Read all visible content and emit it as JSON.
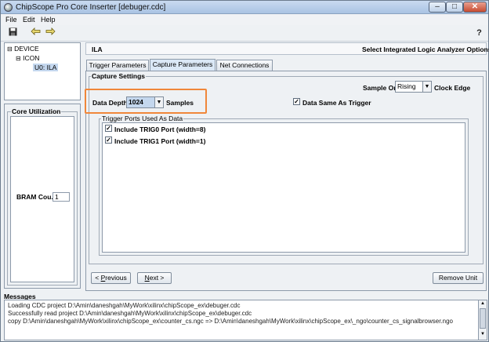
{
  "window": {
    "title": "ChipScope Pro Core Inserter [debuger.cdc]"
  },
  "menu": {
    "file": "File",
    "edit": "Edit",
    "help": "Help"
  },
  "toolbar": {
    "save_icon": "save-icon",
    "back_icon": "arrow-left-icon",
    "forward_icon": "arrow-right-icon",
    "help_icon": "help-icon"
  },
  "tree": {
    "device": "DEVICE",
    "icon": "ICON",
    "ila": "U0: ILA"
  },
  "core_utilization": {
    "title": "Core Utilization",
    "bram_label": "BRAM Cou...",
    "bram_value": "1"
  },
  "header": {
    "core": "ILA",
    "description": "Select Integrated Logic Analyzer Options"
  },
  "tabs": [
    {
      "label": "Trigger Parameters"
    },
    {
      "label": "Capture Parameters"
    },
    {
      "label": "Net Connections"
    }
  ],
  "capture": {
    "group_title": "Capture Settings",
    "sample_on_label": "Sample On",
    "sample_on_value": "Rising",
    "clock_edge_label": "Clock Edge",
    "data_depth_label": "Data Depth:",
    "data_depth_value": "1024",
    "samples_label": "Samples",
    "data_same_label": "Data Same As Trigger",
    "trigger_ports_title": "Trigger Ports Used As Data",
    "ports": [
      {
        "label": "Include TRIG0 Port (width=8)"
      },
      {
        "label": "Include TRIG1 Port (width=1)"
      }
    ],
    "highlight_color": "#f0873a"
  },
  "buttons": {
    "previous_prefix": "< ",
    "previous_ul": "P",
    "previous_rest": "revious",
    "next_ul": "N",
    "next_rest": "ext >",
    "remove": "Remove Unit"
  },
  "messages": {
    "title": "Messages",
    "lines": [
      "Loading CDC project D:\\Amin\\daneshgah\\MyWork\\xilinx\\chipScope_ex\\debuger.cdc",
      "Successfully read project D:\\Amin\\daneshgah\\MyWork\\xilinx\\chipScope_ex\\debuger.cdc",
      "copy D:\\Amin\\daneshgah\\MyWork\\xilinx\\chipScope_ex\\counter_cs.ngc => D:\\Amin\\daneshgah\\MyWork\\xilinx\\chipScope_ex\\_ngo\\counter_cs_signalbrowser.ngo"
    ]
  }
}
